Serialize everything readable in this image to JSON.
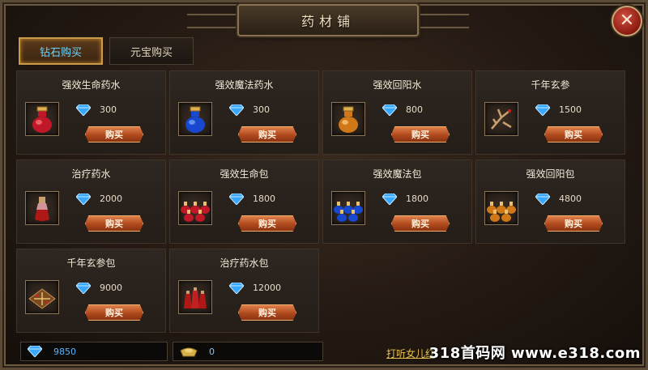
{
  "window": {
    "title": "药材铺"
  },
  "tabs": [
    {
      "label": "钻石购买",
      "active": true
    },
    {
      "label": "元宝购买",
      "active": false
    }
  ],
  "buy_label": "购买",
  "items": [
    {
      "name": "强效生命药水",
      "price": "300",
      "icon": "red-potion-icon"
    },
    {
      "name": "强效魔法药水",
      "price": "300",
      "icon": "blue-potion-icon"
    },
    {
      "name": "强效回阳水",
      "price": "800",
      "icon": "orange-potion-icon"
    },
    {
      "name": "千年玄参",
      "price": "1500",
      "icon": "ginseng-icon"
    },
    {
      "name": "治疗药水",
      "price": "2000",
      "icon": "healing-vial-icon"
    },
    {
      "name": "强效生命包",
      "price": "1800",
      "icon": "red-potion-pack-icon"
    },
    {
      "name": "强效魔法包",
      "price": "1800",
      "icon": "blue-potion-pack-icon"
    },
    {
      "name": "强效回阳包",
      "price": "4800",
      "icon": "orange-potion-pack-icon"
    },
    {
      "name": "千年玄参包",
      "price": "9000",
      "icon": "ginseng-pack-icon"
    },
    {
      "name": "治疗药水包",
      "price": "12000",
      "icon": "healing-vial-pack-icon"
    }
  ],
  "wallet": {
    "diamond": "9850",
    "gold": "0"
  },
  "footer_link": "打听女儿红",
  "watermark": "318首码网 www.e318.com",
  "colors": {
    "accent": "#c89a4a",
    "buy": "#b04a1e",
    "diamond": "#3aa8ff"
  }
}
